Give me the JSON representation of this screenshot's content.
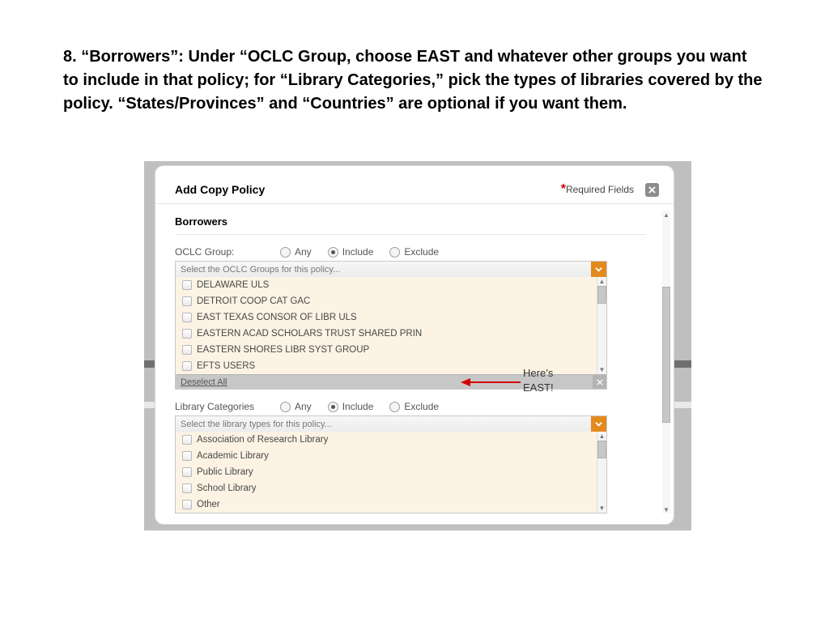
{
  "instruction": "8. “Borrowers”: Under “OCLC Group, choose EAST and whatever other groups you want to include in that policy; for “Library Categories,” pick the types of libraries covered by the policy. “States/Provinces” and “Countries” are optional if you want them.",
  "dialog": {
    "title": "Add Copy Policy",
    "required_label": "Required Fields"
  },
  "section": {
    "borrowers": "Borrowers"
  },
  "radios": {
    "any": "Any",
    "include": "Include",
    "exclude": "Exclude"
  },
  "oclc": {
    "label": "OCLC Group:",
    "placeholder": "Select the OCLC Groups for this policy...",
    "items": [
      "DELAWARE ULS",
      "DETROIT COOP CAT GAC",
      "EAST TEXAS CONSOR OF LIBR ULS",
      "EASTERN ACAD SCHOLARS TRUST SHARED PRIN",
      "EASTERN SHORES LIBR SYST GROUP",
      "EFTS USERS"
    ],
    "deselect": "Deselect All"
  },
  "libcat": {
    "label": "Library Categories",
    "placeholder": "Select the library types for this policy...",
    "items": [
      "Association of Research Library",
      "Academic Library",
      "Public Library",
      "School Library",
      "Other"
    ]
  },
  "callout": {
    "line1": "Here’s",
    "line2": "EAST!"
  }
}
